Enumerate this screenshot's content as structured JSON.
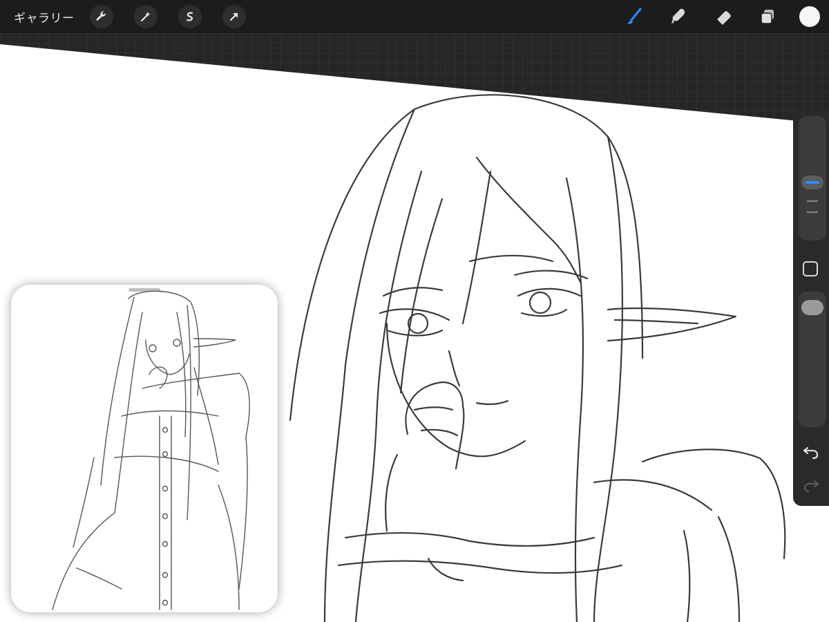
{
  "topbar": {
    "gallery_label": "ギャラリー",
    "left_tools": [
      "wrench-icon",
      "magic-wand-icon",
      "selection-icon",
      "transform-arrow-icon"
    ],
    "right_tools": [
      "brush-icon",
      "smudge-icon",
      "eraser-icon",
      "layers-icon"
    ],
    "current_color": "#f7f7f7",
    "active_tool_color": "#2b8cff"
  },
  "sidebar": {
    "controls": [
      "brush-size-slider",
      "modify-button",
      "opacity-slider",
      "undo-icon",
      "redo-icon"
    ]
  },
  "colors": {
    "toolbar_bg": "#1c1c1c",
    "canvas_bg": "#ffffff",
    "sketch_line": "#3a3a3a",
    "accent": "#2b8cff"
  }
}
